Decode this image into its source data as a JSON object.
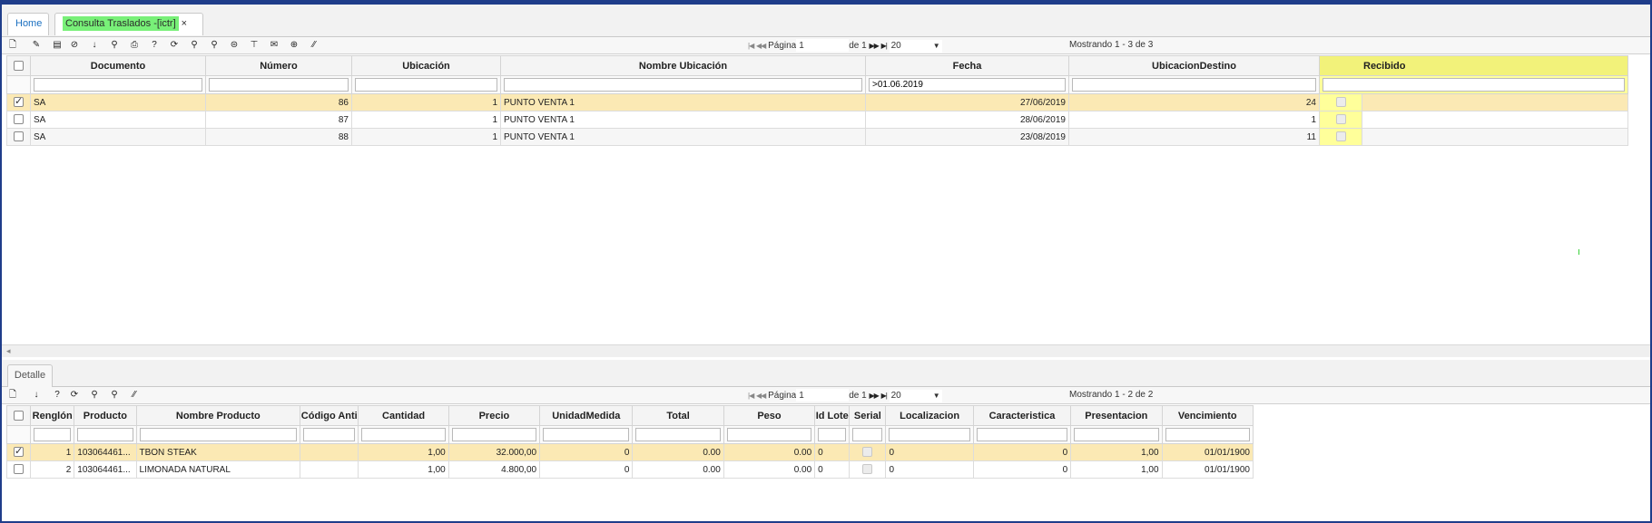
{
  "tabs": {
    "home": "Home",
    "active": "Consulta Traslados -[ictr]",
    "close": "×"
  },
  "toolbar1": {
    "icons": [
      "new-doc-icon",
      "edit-icon",
      "save-icon",
      "cancel-icon",
      "download-icon",
      "search-icon",
      "print-icon",
      "help-icon",
      "refresh-icon",
      "zoom-in-icon",
      "zoom-out-icon",
      "comment-icon",
      "pin-icon",
      "mail-icon",
      "add-icon",
      "resize-icon"
    ],
    "glyphs": [
      "🗋",
      "✎",
      "▤",
      "⊘",
      "↓",
      "⚲",
      "⎙",
      "?",
      "⟳",
      "⚲",
      "⚲",
      "⊜",
      "⊤",
      "✉",
      "⊕",
      "⁄⁄"
    ],
    "pager": {
      "first": "|◀",
      "prev": "◀◀",
      "page_label": "Página",
      "page_value": "1",
      "of_label": "de 1",
      "next": "▶▶",
      "last": "▶|",
      "page_size": "20",
      "caret": "▼"
    },
    "showing": "Mostrando 1 - 3 de 3"
  },
  "master": {
    "columns": [
      "Documento",
      "Número",
      "Ubicación",
      "Nombre Ubicación",
      "Fecha",
      "UbicacionDestino",
      "Recibido"
    ],
    "filters": [
      "",
      "",
      "",
      "",
      ">01.06.2019",
      "",
      ""
    ],
    "rows": [
      {
        "checked": true,
        "documento": "SA",
        "numero": "86",
        "ubicacion": "1",
        "nombre": "PUNTO VENTA 1",
        "fecha": "27/06/2019",
        "destino": "24",
        "recibido": false
      },
      {
        "checked": false,
        "documento": "SA",
        "numero": "87",
        "ubicacion": "1",
        "nombre": "PUNTO VENTA 1",
        "fecha": "28/06/2019",
        "destino": "1",
        "recibido": false
      },
      {
        "checked": false,
        "documento": "SA",
        "numero": "88",
        "ubicacion": "1",
        "nombre": "PUNTO VENTA 1",
        "fecha": "23/08/2019",
        "destino": "11",
        "recibido": false
      }
    ]
  },
  "subtab": "Detalle",
  "toolbar2": {
    "icons": [
      "new-doc-icon",
      "download-icon",
      "help-icon",
      "refresh-icon",
      "zoom-in-icon",
      "search-icon",
      "resize-icon"
    ],
    "glyphs": [
      "🗋",
      "↓",
      "?",
      "⟳",
      "⚲",
      "⚲",
      "⁄⁄"
    ],
    "showing": "Mostrando 1 - 2 de 2"
  },
  "detail": {
    "columns": [
      "Renglón",
      "Producto",
      "Nombre Producto",
      "Código Anti",
      "Cantidad",
      "Precio",
      "UnidadMedida",
      "Total",
      "Peso",
      "Id Lote",
      "Serial",
      "Localizacion",
      "Caracteristica",
      "Presentacion",
      "Vencimiento"
    ],
    "rows": [
      {
        "checked": true,
        "renglon": "1",
        "producto": "103064461...",
        "nombre": "TBON STEAK",
        "codigo": "",
        "cantidad": "1,00",
        "precio": "32.000,00",
        "unidad": "0",
        "total": "0.00",
        "peso": "0.00",
        "lote": "0",
        "serial": false,
        "localizacion": "0",
        "caracteristica": "0",
        "presentacion": "1,00",
        "vencimiento": "01/01/1900"
      },
      {
        "checked": false,
        "renglon": "2",
        "producto": "103064461...",
        "nombre": "LIMONADA NATURAL",
        "codigo": "",
        "cantidad": "1,00",
        "precio": "4.800,00",
        "unidad": "0",
        "total": "0.00",
        "peso": "0.00",
        "lote": "0",
        "serial": false,
        "localizacion": "0",
        "caracteristica": "0",
        "presentacion": "1,00",
        "vencimiento": "01/01/1900"
      }
    ]
  },
  "colors": {
    "frame": "#1f3d8a",
    "tab_active": "#78f078",
    "row_selected": "#fbe9b4",
    "highlight": "#ffff9a"
  }
}
